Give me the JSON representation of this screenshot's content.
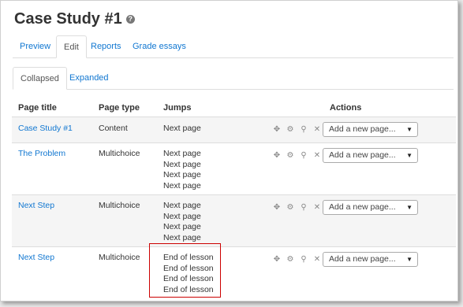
{
  "page": {
    "title": "Case Study #1"
  },
  "tabs": [
    "Preview",
    "Edit",
    "Reports",
    "Grade essays"
  ],
  "subtabs": [
    "Collapsed",
    "Expanded"
  ],
  "columns": {
    "title": "Page title",
    "type": "Page type",
    "jumps": "Jumps",
    "actions": "Actions"
  },
  "rows": [
    {
      "title": "Case Study #1",
      "type": "Content",
      "jumps": [
        "Next page"
      ]
    },
    {
      "title": "The Problem",
      "type": "Multichoice",
      "jumps": [
        "Next page",
        "Next page",
        "Next page",
        "Next page"
      ]
    },
    {
      "title": "Next Step",
      "type": "Multichoice",
      "jumps": [
        "Next page",
        "Next page",
        "Next page",
        "Next page"
      ]
    },
    {
      "title": "Next Step",
      "type": "Multichoice",
      "jumps": [
        "End of lesson",
        "End of lesson",
        "End of lesson",
        "End of lesson"
      ]
    }
  ],
  "select": {
    "placeholder": "Add a new page..."
  },
  "colors": {
    "link": "#1177d1",
    "highlight": "#cc0000"
  }
}
